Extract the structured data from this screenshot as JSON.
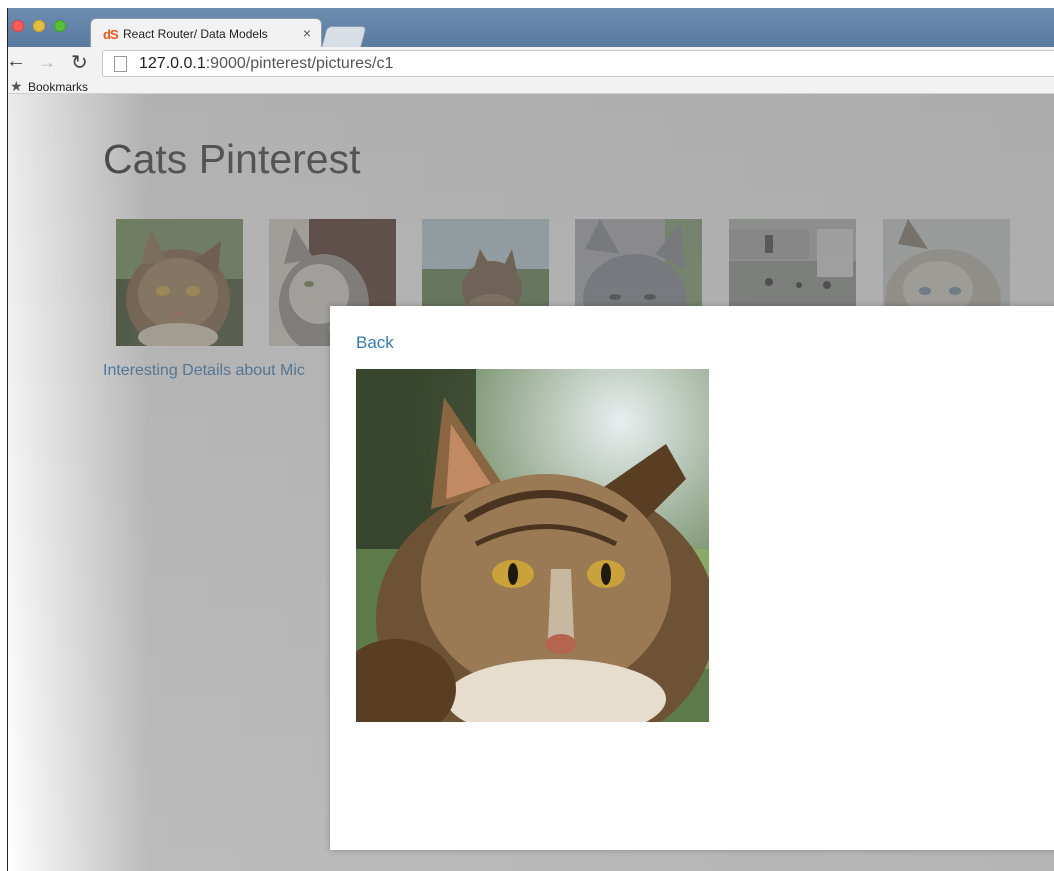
{
  "browser": {
    "tab_title": "React Router/ Data Models",
    "tab_close": "×",
    "favicon_text": "dS",
    "url_host": "127.0.0.1",
    "url_rest": ":9000/pinterest/pictures/c1",
    "bookmarks_label": "Bookmarks"
  },
  "page": {
    "title": "Cats Pinterest",
    "thumbnails": [
      {
        "name": "cat-thumb-1",
        "icon": "maine-coon-cat"
      },
      {
        "name": "cat-thumb-2",
        "icon": "tabby-white-cat"
      },
      {
        "name": "cat-thumb-3",
        "icon": "tabby-cat-outdoors"
      },
      {
        "name": "cat-thumb-4",
        "icon": "gray-cat"
      },
      {
        "name": "cat-thumb-5",
        "icon": "cats-on-street"
      },
      {
        "name": "cat-thumb-6",
        "icon": "siamese-cat"
      }
    ],
    "detail_link": "Interesting Details about Mic"
  },
  "modal": {
    "back_label": "Back",
    "picture": "maine-coon-cat"
  },
  "colors": {
    "link": "#337ab7",
    "title": "#333333"
  }
}
